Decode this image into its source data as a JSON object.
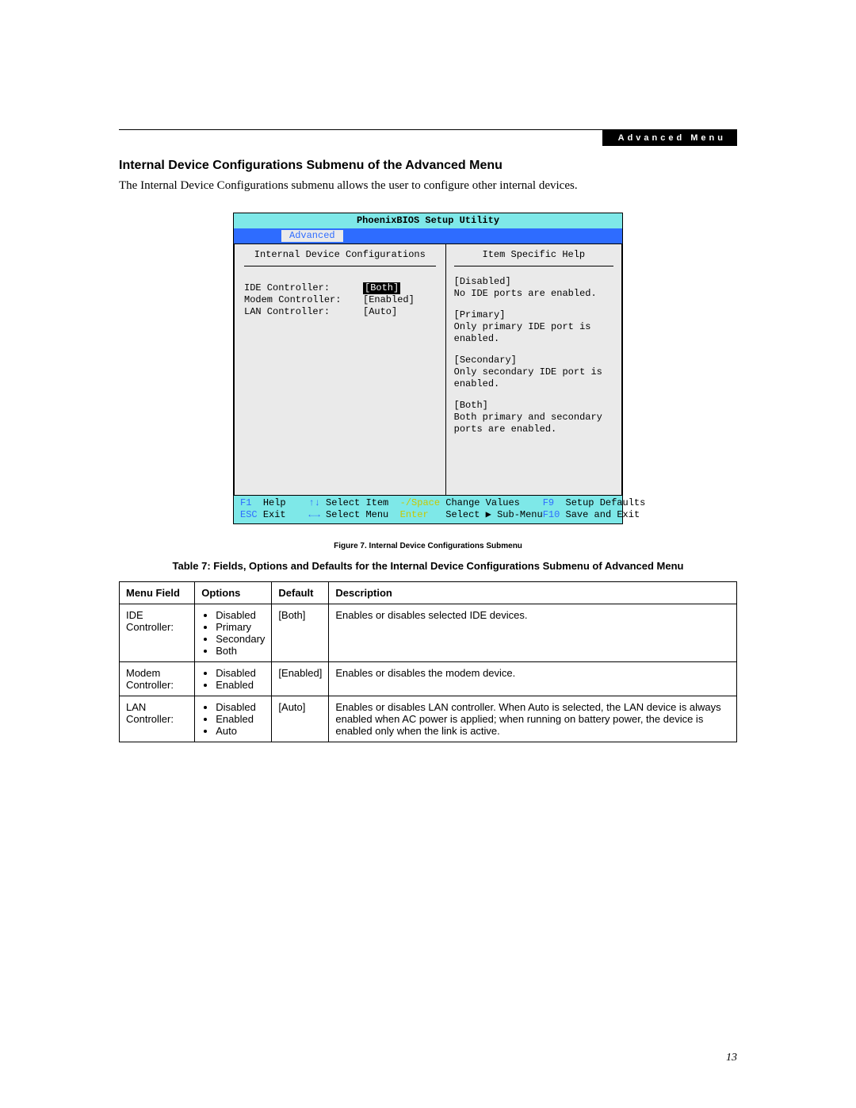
{
  "header": {
    "section_tag": "Advanced Menu"
  },
  "heading": "Internal Device Configurations Submenu of the Advanced Menu",
  "intro": "The Internal Device Configurations submenu allows the user to configure other internal devices.",
  "bios": {
    "title": "PhoenixBIOS Setup Utility",
    "active_tab": "Advanced",
    "panel_title": "Internal Device Configurations",
    "help_title": "Item Specific Help",
    "fields": [
      {
        "label": "IDE Controller:",
        "value": "[Both]",
        "selected": true
      },
      {
        "label": "Modem Controller:",
        "value": "[Enabled]",
        "selected": false
      },
      {
        "label": "LAN Controller:",
        "value": "[Auto]",
        "selected": false
      }
    ],
    "help": [
      {
        "key": "[Disabled]",
        "text": "No IDE ports are enabled."
      },
      {
        "key": "[Primary]",
        "text": "Only primary IDE port is enabled."
      },
      {
        "key": "[Secondary]",
        "text": "Only secondary IDE port is enabled."
      },
      {
        "key": "[Both]",
        "text": "Both primary and secondary ports are enabled."
      }
    ],
    "footer": {
      "f1": "F1",
      "help": "Help",
      "arrows_v": "↑↓",
      "select_item": "Select Item",
      "chg_keys": "-/Space",
      "change_values": "Change Values",
      "f9": "F9",
      "setup_defaults": "Setup Defaults",
      "esc": "ESC",
      "exit": "Exit",
      "arrows_h": "←→",
      "select_menu": "Select Menu",
      "enter": "Enter",
      "select_submenu": "Select ▶ Sub-Menu",
      "f10": "F10",
      "save_exit": "Save and Exit"
    }
  },
  "figure_caption": "Figure 7.  Internal Device Configurations Submenu",
  "table_caption": "Table 7: Fields, Options and Defaults for the Internal Device Configurations Submenu of Advanced Menu",
  "table": {
    "headers": [
      "Menu Field",
      "Options",
      "Default",
      "Description"
    ],
    "rows": [
      {
        "field": "IDE Controller:",
        "options": [
          "Disabled",
          "Primary",
          "Secondary",
          "Both"
        ],
        "default": "[Both]",
        "description": "Enables or disables selected IDE devices."
      },
      {
        "field": "Modem Controller:",
        "options": [
          "Disabled",
          "Enabled"
        ],
        "default": "[Enabled]",
        "description": "Enables or disables the modem device."
      },
      {
        "field": "LAN Controller:",
        "options": [
          "Disabled",
          "Enabled",
          "Auto"
        ],
        "default": "[Auto]",
        "description": "Enables or disables LAN controller. When Auto is selected, the LAN device is always enabled when AC power is applied; when running on battery power, the device is enabled only when the link is active."
      }
    ]
  },
  "page_number": "13"
}
